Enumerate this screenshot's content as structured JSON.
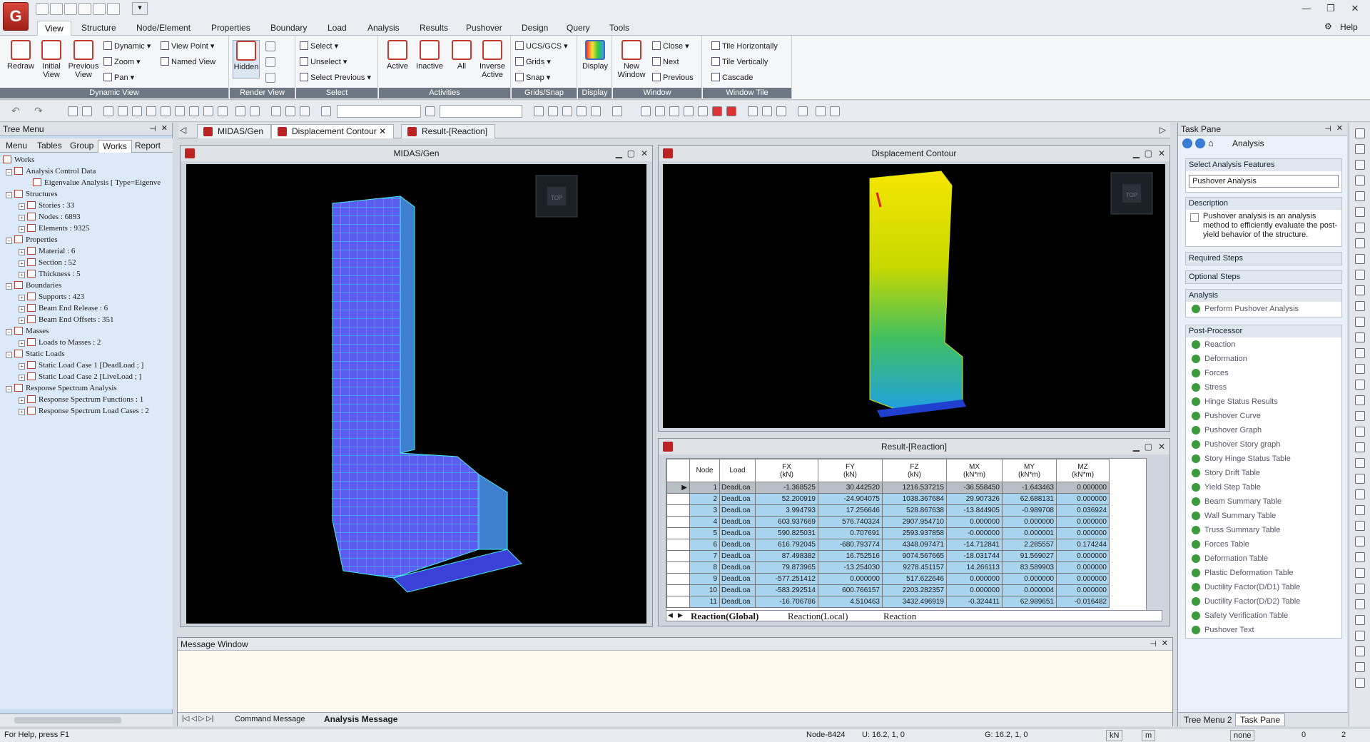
{
  "app": {
    "quick_access_menu": "▾",
    "help": "Help"
  },
  "ribbon_tabs": [
    "View",
    "Structure",
    "Node/Element",
    "Properties",
    "Boundary",
    "Load",
    "Analysis",
    "Results",
    "Pushover",
    "Design",
    "Query",
    "Tools"
  ],
  "ribbon": {
    "dynamic_view": {
      "label": "Dynamic View",
      "redraw": "Redraw",
      "initial_view": "Initial View",
      "previous_view": "Previous View",
      "dynamic": "Dynamic",
      "zoom": "Zoom",
      "pan": "Pan",
      "view_point": "View Point",
      "named_view": "Named View"
    },
    "render_view": {
      "label": "Render View",
      "hidden": "Hidden"
    },
    "select": {
      "label": "Select",
      "select": "Select",
      "unselect": "Unselect",
      "select_previous": "Select Previous"
    },
    "activities": {
      "label": "Activities",
      "active": "Active",
      "inactive": "Inactive",
      "all": "All",
      "inverse_active": "Inverse Active"
    },
    "grids_snap": {
      "label": "Grids/Snap",
      "ucs": "UCS/GCS",
      "grids": "Grids",
      "snap": "Snap"
    },
    "display": {
      "label": "Display",
      "display": "Display"
    },
    "window": {
      "label": "Window",
      "new_window": "New Window",
      "close": "Close",
      "next": "Next",
      "previous": "Previous"
    },
    "window_tile": {
      "label": "Window Tile",
      "tile_h": "Tile Horizontally",
      "tile_v": "Tile Vertically",
      "cascade": "Cascade"
    }
  },
  "tree": {
    "title": "Tree Menu",
    "tabs": [
      "Menu",
      "Tables",
      "Group",
      "Works",
      "Report"
    ],
    "items": [
      "Works",
      "Analysis Control Data",
      "Eigenvalue Analysis [ Type=Eigenve",
      "Structures",
      "Stories : 33",
      "Nodes : 6893",
      "Elements : 9325",
      "Properties",
      "Material : 6",
      "Section : 52",
      "Thickness : 5",
      "Boundaries",
      "Supports : 423",
      "Beam End Release : 6",
      "Beam End Offsets : 351",
      "Masses",
      "Loads to Masses : 2",
      "Static Loads",
      "Static Load Case 1 [DeadLoad ; ]",
      "Static Load Case 2 [LiveLoad ; ]",
      "Response Spectrum Analysis",
      "Response Spectrum Functions : 1",
      "Response Spectrum Load Cases : 2"
    ]
  },
  "doc_tabs": [
    "MIDAS/Gen",
    "Displacement Contour",
    "Result-[Reaction]"
  ],
  "windows": {
    "midas": "MIDAS/Gen",
    "contour": "Displacement Contour",
    "result": "Result-[Reaction]",
    "view_cube": "TOP"
  },
  "table": {
    "headers": [
      [
        "Node",
        ""
      ],
      [
        "Load",
        ""
      ],
      [
        "FX",
        "(kN)"
      ],
      [
        "FY",
        "(kN)"
      ],
      [
        "FZ",
        "(kN)"
      ],
      [
        "MX",
        "(kN*m)"
      ],
      [
        "MY",
        "(kN*m)"
      ],
      [
        "MZ",
        "(kN*m)"
      ]
    ],
    "rows": [
      [
        "1",
        "DeadLoa",
        "-1.368525",
        "30.442520",
        "1216.537215",
        "-36.558450",
        "-1.643463",
        "0.000000"
      ],
      [
        "2",
        "DeadLoa",
        "52.200919",
        "-24.904075",
        "1038.367684",
        "29.907326",
        "62.688131",
        "0.000000"
      ],
      [
        "3",
        "DeadLoa",
        "3.994793",
        "17.256646",
        "528.867638",
        "-13.844905",
        "-0.989708",
        "0.036924"
      ],
      [
        "4",
        "DeadLoa",
        "603.937669",
        "576.740324",
        "2907.954710",
        "0.000000",
        "0.000000",
        "0.000000"
      ],
      [
        "5",
        "DeadLoa",
        "590.825031",
        "0.707691",
        "2593.937858",
        "-0.000000",
        "0.000001",
        "0.000000"
      ],
      [
        "6",
        "DeadLoa",
        "616.792045",
        "-680.793774",
        "4348.097471",
        "-14.712841",
        "2.285557",
        "0.174244"
      ],
      [
        "7",
        "DeadLoa",
        "87.498382",
        "16.752516",
        "9074.567665",
        "-18.031744",
        "91.569027",
        "0.000000"
      ],
      [
        "8",
        "DeadLoa",
        "79.873965",
        "-13.254030",
        "9278.451157",
        "14.266113",
        "83.589903",
        "0.000000"
      ],
      [
        "9",
        "DeadLoa",
        "-577.251412",
        "0.000000",
        "517.622646",
        "0.000000",
        "0.000000",
        "0.000000"
      ],
      [
        "10",
        "DeadLoa",
        "-583.292514",
        "600.766157",
        "2203.282357",
        "0.000000",
        "0.000004",
        "0.000000"
      ],
      [
        "11",
        "DeadLoa",
        "-16.706786",
        "4.510463",
        "3432.496919",
        "-0.324411",
        "62.989651",
        "-0.016482"
      ]
    ],
    "sheet_tabs": [
      "Reaction(Global)",
      "Reaction(Local)",
      "Reaction"
    ]
  },
  "message": {
    "title": "Message Window",
    "tabs": [
      "Command Message",
      "Analysis Message"
    ]
  },
  "task": {
    "title": "Task Pane",
    "nav": "Analysis",
    "features_head": "Select Analysis Features",
    "features_value": "Pushover Analysis",
    "desc_head": "Description",
    "desc_text": "Pushover analysis is an analysis method to efficiently evaluate the post-yield behavior of the structure.",
    "required": "Required Steps",
    "optional": "Optional Steps",
    "analysis_head": "Analysis",
    "perform": "Perform Pushover Analysis",
    "post_head": "Post-Processor",
    "post_items": [
      "Reaction",
      "Deformation",
      "Forces",
      "Stress",
      "Hinge Status Results",
      "Pushover Curve",
      "Pushover Graph",
      "Pushover Story graph",
      "Story Hinge Status Table",
      "Story Drift Table",
      "Yield Step Table",
      "Beam Summary Table",
      "Wall Summary Table",
      "Truss Summary Table",
      "Forces Table",
      "Deformation Table",
      "Plastic Deformation Table",
      "Ductility Factor(D/D1) Table",
      "Ductility Factor(D/D2) Table",
      "Safety Verification Table",
      "Pushover Text"
    ],
    "bottom_tabs": [
      "Tree Menu 2",
      "Task Pane"
    ]
  },
  "status": {
    "help": "For Help, press F1",
    "node": "Node-8424",
    "u": "U: 16.2, 1, 0",
    "g": "G: 16.2, 1, 0",
    "unit_force": "kN",
    "unit_len": "m",
    "snap": "none",
    "v1": "0",
    "v2": "2"
  },
  "colors": {
    "accent": "#c23a30",
    "tree_bg": "#dce9f8",
    "cell_bg": "#a8d4f0"
  }
}
